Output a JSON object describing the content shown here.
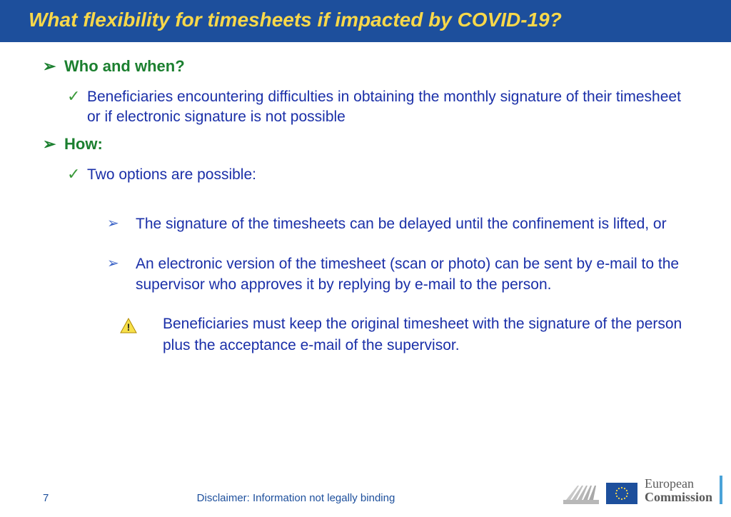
{
  "header": {
    "title": "What flexibility for timesheets if impacted by COVID-19?"
  },
  "sections": {
    "who": {
      "heading": "Who and when?",
      "item": "Beneficiaries encountering difficulties in obtaining the monthly signature of their timesheet or if electronic signature is not possible"
    },
    "how": {
      "heading": "How:",
      "intro": "Two options are possible:",
      "opt1": "The signature of the timesheets can be delayed until the confinement is lifted, or",
      "opt2": "An electronic version of the timesheet (scan or photo) can be sent by e-mail to the supervisor who approves it by replying by e-mail to the person.",
      "warning": "Beneficiaries must keep the original timesheet with the signature of the person plus the acceptance e-mail of the supervisor."
    }
  },
  "footer": {
    "page": "7",
    "disclaimer": "Disclaimer: Information not legally binding",
    "logo_line1": "European",
    "logo_line2": "Commission"
  }
}
